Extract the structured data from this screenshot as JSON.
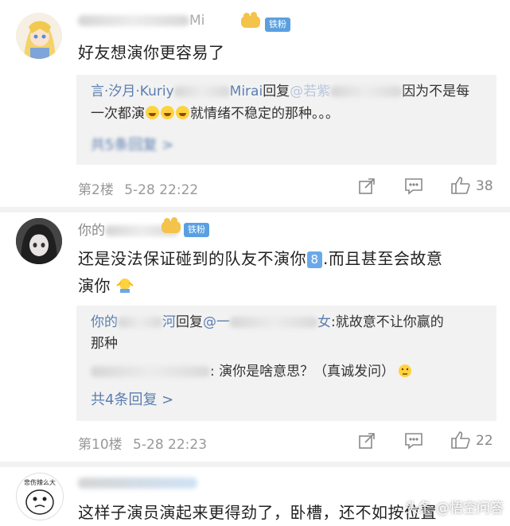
{
  "comments": [
    {
      "username_visible": "Mi",
      "badge": "铁粉",
      "text": "好友想演你更容易了",
      "reply": {
        "line1_name": "言·汐月·Kuriy",
        "line1_name2": "Mirai",
        "line1_reply_word": "回复",
        "line1_at": "@若紫",
        "line1_text": "因为不是每",
        "line2_text": "一次都演",
        "line2_text_after": "就情绪不稳定的那种。。。",
        "more": "共5条回复 >"
      },
      "floor": "第2楼",
      "time": "5-28 22:22",
      "likes": "38"
    },
    {
      "username_visible": "你的",
      "badge": "铁粉",
      "text_line1_a": "还是没法保证碰到的队友不演你",
      "text_line1_key": "8",
      "text_line1_b": ".而且甚至会故意",
      "text_line2": "演你",
      "reply": {
        "r1_name": "你的",
        "r1_name2": "河",
        "r1_reply_word": "回复",
        "r1_at": "@一",
        "r1_at2": "女",
        "r1_text": ":就故意不让你赢的",
        "r1_line2": "那种",
        "r2_text": ": 演你是啥意思？（真诚发问）",
        "more": "共4条回复 >"
      },
      "floor": "第10楼",
      "time": "5-28 22:23",
      "likes": "22"
    },
    {
      "avatar_caption": "悲伤辣么大",
      "text": "这样子演员演起来更得劲了，卧槽，还不如按位置"
    }
  ],
  "watermark": "头条 @悟空问答",
  "colors": {
    "link": "#5b7eb0",
    "badge": "#5aa0e0",
    "reply_bg": "#f2f2f2"
  }
}
